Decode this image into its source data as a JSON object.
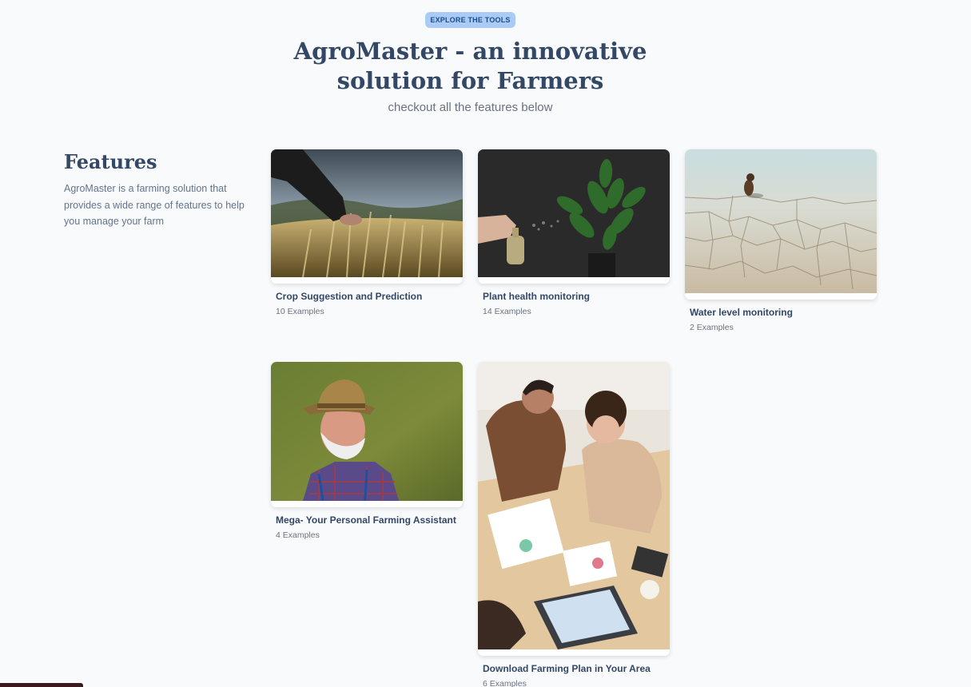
{
  "hero": {
    "badge": "EXPLORE THE TOOLS",
    "title": "AgroMaster - an innovative solution for Farmers",
    "subtitle": "checkout all the features below"
  },
  "sidebar": {
    "title": "Features",
    "description": "AgroMaster is a farming solution that provides a wide range of features to help you manage your farm"
  },
  "cards": [
    {
      "title": "Crop Suggestion and Prediction",
      "count": "10 Examples",
      "image": "wheat-field-hand"
    },
    {
      "title": "Plant health monitoring",
      "count": "14 Examples",
      "image": "plant-spray"
    },
    {
      "title": "Water level monitoring",
      "count": "2 Examples",
      "image": "cracked-dry-ground-dog"
    },
    {
      "title": "Mega- Your Personal Farming Assistant",
      "count": "4 Examples",
      "image": "farmer-with-hat"
    },
    {
      "title": "Download Farming Plan in Your Area",
      "count": "6 Examples",
      "image": "team-meeting-table"
    }
  ]
}
